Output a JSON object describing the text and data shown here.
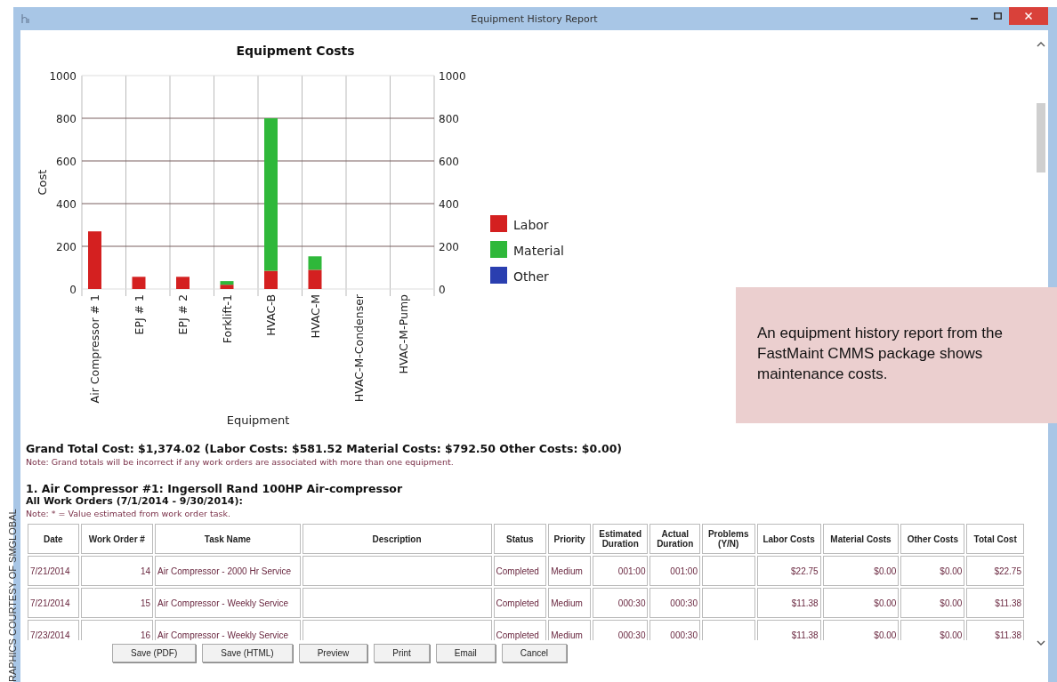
{
  "window": {
    "title": "Equipment History Report"
  },
  "chart": {
    "chart_data": {
      "type": "bar",
      "title": "Equipment Costs",
      "xlabel": "Equipment",
      "ylabel": "Cost",
      "stacked": true,
      "categories": [
        "Air Compressor # 1",
        "EPJ # 1",
        "EPJ # 2",
        "Forklift-1",
        "HVAC-B",
        "HVAC-M",
        "HVAC-M-Condenser",
        "HVAC-M-Pump"
      ],
      "series": [
        {
          "name": "Labor",
          "color": "#d42020",
          "values": [
            270,
            57,
            57,
            20,
            85,
            90,
            0,
            0
          ]
        },
        {
          "name": "Material",
          "color": "#2fb83a",
          "values": [
            0,
            0,
            0,
            17,
            715,
            63,
            0,
            0
          ]
        },
        {
          "name": "Other",
          "color": "#2a3fb0",
          "values": [
            0,
            0,
            0,
            0,
            0,
            0,
            0,
            0
          ]
        }
      ],
      "ylim": [
        0,
        1000
      ],
      "yticks": [
        0,
        200,
        400,
        600,
        800,
        1000
      ],
      "y2lim": [
        0,
        1000
      ],
      "y2ticks": [
        0,
        200,
        400,
        600,
        800,
        1000
      ],
      "grid": true,
      "legend": true
    }
  },
  "summary": {
    "grand_total": "Grand Total Cost: $1,374.02 (Labor Costs: $581.52 Material Costs: $792.50 Other Costs: $0.00)",
    "note": "Note: Grand totals will be incorrect if any work orders are associated with more than one equipment."
  },
  "section": {
    "heading": "1. Air Compressor #1: Ingersoll Rand 100HP Air-compressor",
    "subheading": "All Work Orders (7/1/2014 - 9/30/2014):",
    "note": "Note: * = Value estimated from work order task."
  },
  "table": {
    "columns": [
      "Date",
      "Work Order #",
      "Task Name",
      "Description",
      "Status",
      "Priority",
      "Estimated Duration",
      "Actual Duration",
      "Problems (Y/N)",
      "Labor Costs",
      "Material Costs",
      "Other Costs",
      "Total Cost"
    ],
    "rows": [
      [
        "7/21/2014",
        "14",
        "Air Compressor - 2000 Hr Service",
        "",
        "Completed",
        "Medium",
        "001:00",
        "001:00",
        "",
        "$22.75",
        "$0.00",
        "$0.00",
        "$22.75"
      ],
      [
        "7/21/2014",
        "15",
        "Air Compressor - Weekly Service",
        "",
        "Completed",
        "Medium",
        "000:30",
        "000:30",
        "",
        "$11.38",
        "$0.00",
        "$0.00",
        "$11.38"
      ],
      [
        "7/23/2014",
        "16",
        "Air Compressor - Weekly Service",
        "",
        "Completed",
        "Medium",
        "000:30",
        "000:30",
        "",
        "$11.38",
        "$0.00",
        "$0.00",
        "$11.38"
      ]
    ]
  },
  "buttons": [
    "Save (PDF)",
    "Save (HTML)",
    "Preview",
    "Print",
    "Email",
    "Cancel"
  ],
  "caption": "An equipment history report from the FastMaint CMMS package shows maintenance costs.",
  "credit": "RAPHICS COURTESY OF SMGLOBAL"
}
